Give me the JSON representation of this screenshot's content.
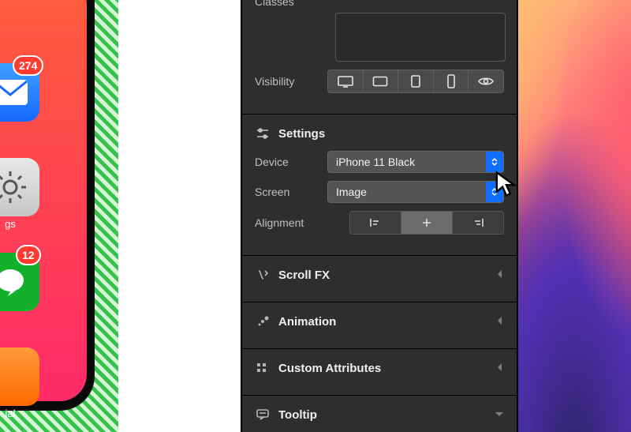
{
  "phone": {
    "mail_badge": "274",
    "line_badge": "12",
    "settings_label_fragment": "gs",
    "bottom_label_fragment": "ial"
  },
  "inspector": {
    "classes_label": "Classes",
    "visibility_label": "Visibility",
    "sections": {
      "settings": {
        "title": "Settings"
      },
      "scrollfx": {
        "title": "Scroll FX"
      },
      "animation": {
        "title": "Animation"
      },
      "custom_attributes": {
        "title": "Custom Attributes"
      },
      "tooltip": {
        "title": "Tooltip"
      }
    },
    "device": {
      "label": "Device",
      "value": "iPhone 11 Black"
    },
    "screen": {
      "label": "Screen",
      "value": "Image"
    },
    "alignment": {
      "label": "Alignment",
      "selected": "center",
      "options": [
        "left",
        "center",
        "right"
      ]
    },
    "visibility_buttons": [
      "desktop",
      "tablet-landscape",
      "tablet-portrait",
      "phone",
      "visible"
    ]
  }
}
